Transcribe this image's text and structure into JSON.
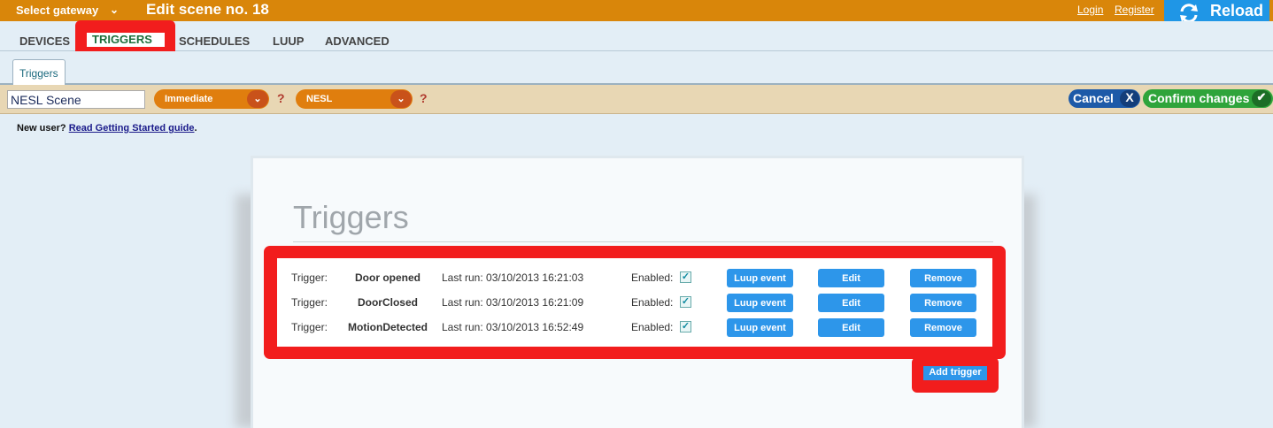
{
  "topbar": {
    "gateway_select": "Select gateway",
    "scene_title": "Edit scene no. 18",
    "login": "Login",
    "register": "Register",
    "reload": "Reload"
  },
  "nav": {
    "tabs": [
      {
        "label": "DEVICES"
      },
      {
        "label": "TRIGGERS",
        "active": true
      },
      {
        "label": "SCHEDULES"
      },
      {
        "label": "LUUP"
      },
      {
        "label": "ADVANCED"
      }
    ]
  },
  "subtab": {
    "label": "Triggers"
  },
  "toolbar": {
    "scene_name": "NESL Scene",
    "mode_select": "Immediate",
    "room_select": "NESL",
    "help": "?",
    "cancel": "Cancel",
    "cancel_icon": "X",
    "confirm": "Confirm changes",
    "confirm_icon": "✔"
  },
  "newuser": {
    "prefix": "New user? ",
    "link": "Read Getting Started guide",
    "suffix": "."
  },
  "triggers": {
    "title": "Triggers",
    "rows": [
      {
        "label": "Trigger:",
        "name": "Door opened",
        "last_run": "Last run: 03/10/2013 16:21:03",
        "enabled_label": "Enabled:",
        "enabled": true,
        "luup": "Luup event",
        "edit": "Edit",
        "remove": "Remove"
      },
      {
        "label": "Trigger:",
        "name": "DoorClosed",
        "last_run": "Last run: 03/10/2013 16:21:09",
        "enabled_label": "Enabled:",
        "enabled": true,
        "luup": "Luup event",
        "edit": "Edit",
        "remove": "Remove"
      },
      {
        "label": "Trigger:",
        "name": "MotionDetected",
        "last_run": "Last run: 03/10/2013 16:52:49",
        "enabled_label": "Enabled:",
        "enabled": true,
        "luup": "Luup event",
        "edit": "Edit",
        "remove": "Remove"
      }
    ],
    "add": "Add trigger"
  },
  "colors": {
    "topbar": "#d9860a",
    "highlight": "#f21d1d",
    "button_blue": "#2d96ea"
  }
}
